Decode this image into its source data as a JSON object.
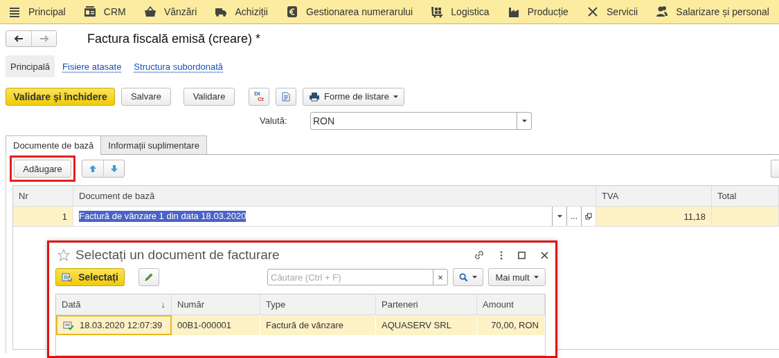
{
  "menu": [
    {
      "label": "Principal"
    },
    {
      "label": "CRM"
    },
    {
      "label": "Vânzări"
    },
    {
      "label": "Achiziții"
    },
    {
      "label": "Gestionarea numerarului"
    },
    {
      "label": "Logistica"
    },
    {
      "label": "Producție"
    },
    {
      "label": "Servicii"
    },
    {
      "label": "Salarizare și personal"
    }
  ],
  "title": "Factura fiscală emisă (creare) *",
  "form_tabs": [
    {
      "label": "Principală",
      "selected": true
    },
    {
      "label": "Fisiere atasate",
      "selected": false
    },
    {
      "label": "Structura subordonată",
      "selected": false
    }
  ],
  "toolbar": {
    "primary": "Validare şi închidere",
    "buttons": [
      "Salvare",
      "Validare"
    ],
    "dt": "Dt",
    "ct": "Ct",
    "print": "Forme de listare"
  },
  "currency": {
    "label": "Valută:",
    "value": "RON"
  },
  "tabs": [
    {
      "label": "Documente de bază",
      "selected": true
    },
    {
      "label": "Informații suplimentare",
      "selected": false
    }
  ],
  "add_button": {
    "label": "Adăugare",
    "highlighted": true
  },
  "table": {
    "columns": [
      "Nr",
      "Document de bază",
      "TVA",
      "Total"
    ],
    "rows": [
      {
        "nr": "1",
        "document": "Factură de vânzare 1 din data 18.03.2020",
        "ellipsis": "...",
        "tva": "11,18",
        "selected": true
      }
    ]
  },
  "dialog": {
    "title": "Selectați un document de facturare",
    "highlighted": true,
    "select_button": "Selectați",
    "search": {
      "placeholder": "Căutare (Ctrl + F)",
      "clear": "×"
    },
    "more": "Mai mult",
    "columns": [
      {
        "label": "Dată",
        "sort": "↓"
      },
      {
        "label": "Număr"
      },
      {
        "label": "Type"
      },
      {
        "label": "Parteneri"
      },
      {
        "label": "Amount"
      }
    ],
    "rows": [
      {
        "date": "18.03.2020 12:07:39",
        "number": "00B1-000001",
        "type": "Factură de vânzare",
        "partner": "AQUASERV SRL",
        "amount": "70,00, RON",
        "selected": true
      }
    ]
  }
}
